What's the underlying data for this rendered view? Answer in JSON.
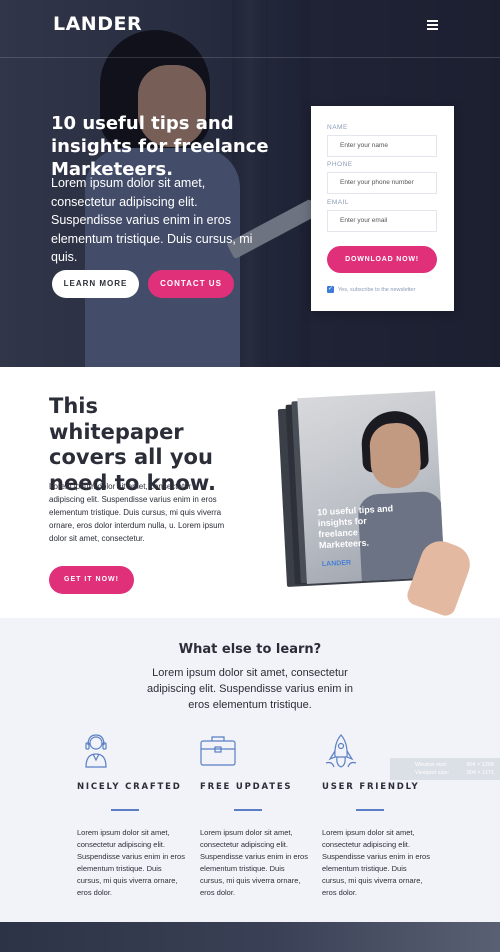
{
  "header": {
    "logo": "LANDER"
  },
  "hero": {
    "title": "10 useful tips and insights for freelance Marketeers.",
    "text": "Lorem ipsum dolor sit amet, consectetur adipiscing elit. Suspendisse varius enim in eros elementum tristique. Duis cursus, mi quis.",
    "learn_more": "LEARN MORE",
    "contact_us": "CONTACT US"
  },
  "form": {
    "name_label": "NAME",
    "name_placeholder": "Enter your name",
    "phone_label": "PHONE",
    "phone_placeholder": "Enter your phone number",
    "email_label": "EMAIL",
    "email_placeholder": "Enter your email",
    "submit": "DOWNLOAD NOW!",
    "newsletter": "Yes, subscribe to the newsletter"
  },
  "whitepaper": {
    "title": "This whitepaper covers all you need to know.",
    "text": "Lorem ipsum dolor sit amet, consectetur adipiscing elit. Suspendisse varius enim in eros elementum tristique. Duis cursus, mi quis viverra ornare, eros dolor interdum nulla, u. Lorem ipsum dolor sit amet, consectetur.",
    "button": "GET IT NOW!",
    "cover_title": "10 useful tips and insights for freelance Marketeers.",
    "cover_logo": "LANDER"
  },
  "learn": {
    "title": "What else to learn?",
    "subtitle": "Lorem ipsum dolor sit amet, consectetur adipiscing elit. Suspendisse varius enim in eros elementum tristique.",
    "features": [
      {
        "icon": "support-agent-icon",
        "title": "NICELY CRAFTED",
        "text": "Lorem ipsum dolor sit amet, consectetur adipiscing elit. Suspendisse varius enim in eros elementum tristique. Duis cursus, mi quis viverra ornare, eros dolor."
      },
      {
        "icon": "briefcase-icon",
        "title": "FREE UPDATES",
        "text": "Lorem ipsum dolor sit amet, consectetur adipiscing elit. Suspendisse varius enim in eros elementum tristique. Duis cursus, mi quis viverra ornare, eros dolor."
      },
      {
        "icon": "rocket-icon",
        "title": "USER FRIENDLY",
        "text": "Lorem ipsum dolor sit amet, consectetur adipiscing elit. Suspendisse varius enim in eros elementum tristique. Duis cursus, mi quis viverra ornare, eros dolor."
      }
    ]
  },
  "watermark": {
    "window_size_label": "Window size:",
    "window_size": "904 × 1268",
    "viewport_label": "Viewport size:",
    "viewport": "904 × 1171"
  },
  "colors": {
    "accent": "#e0307a",
    "blue": "#3d7bd8",
    "section_bg": "#f1f3f8"
  }
}
